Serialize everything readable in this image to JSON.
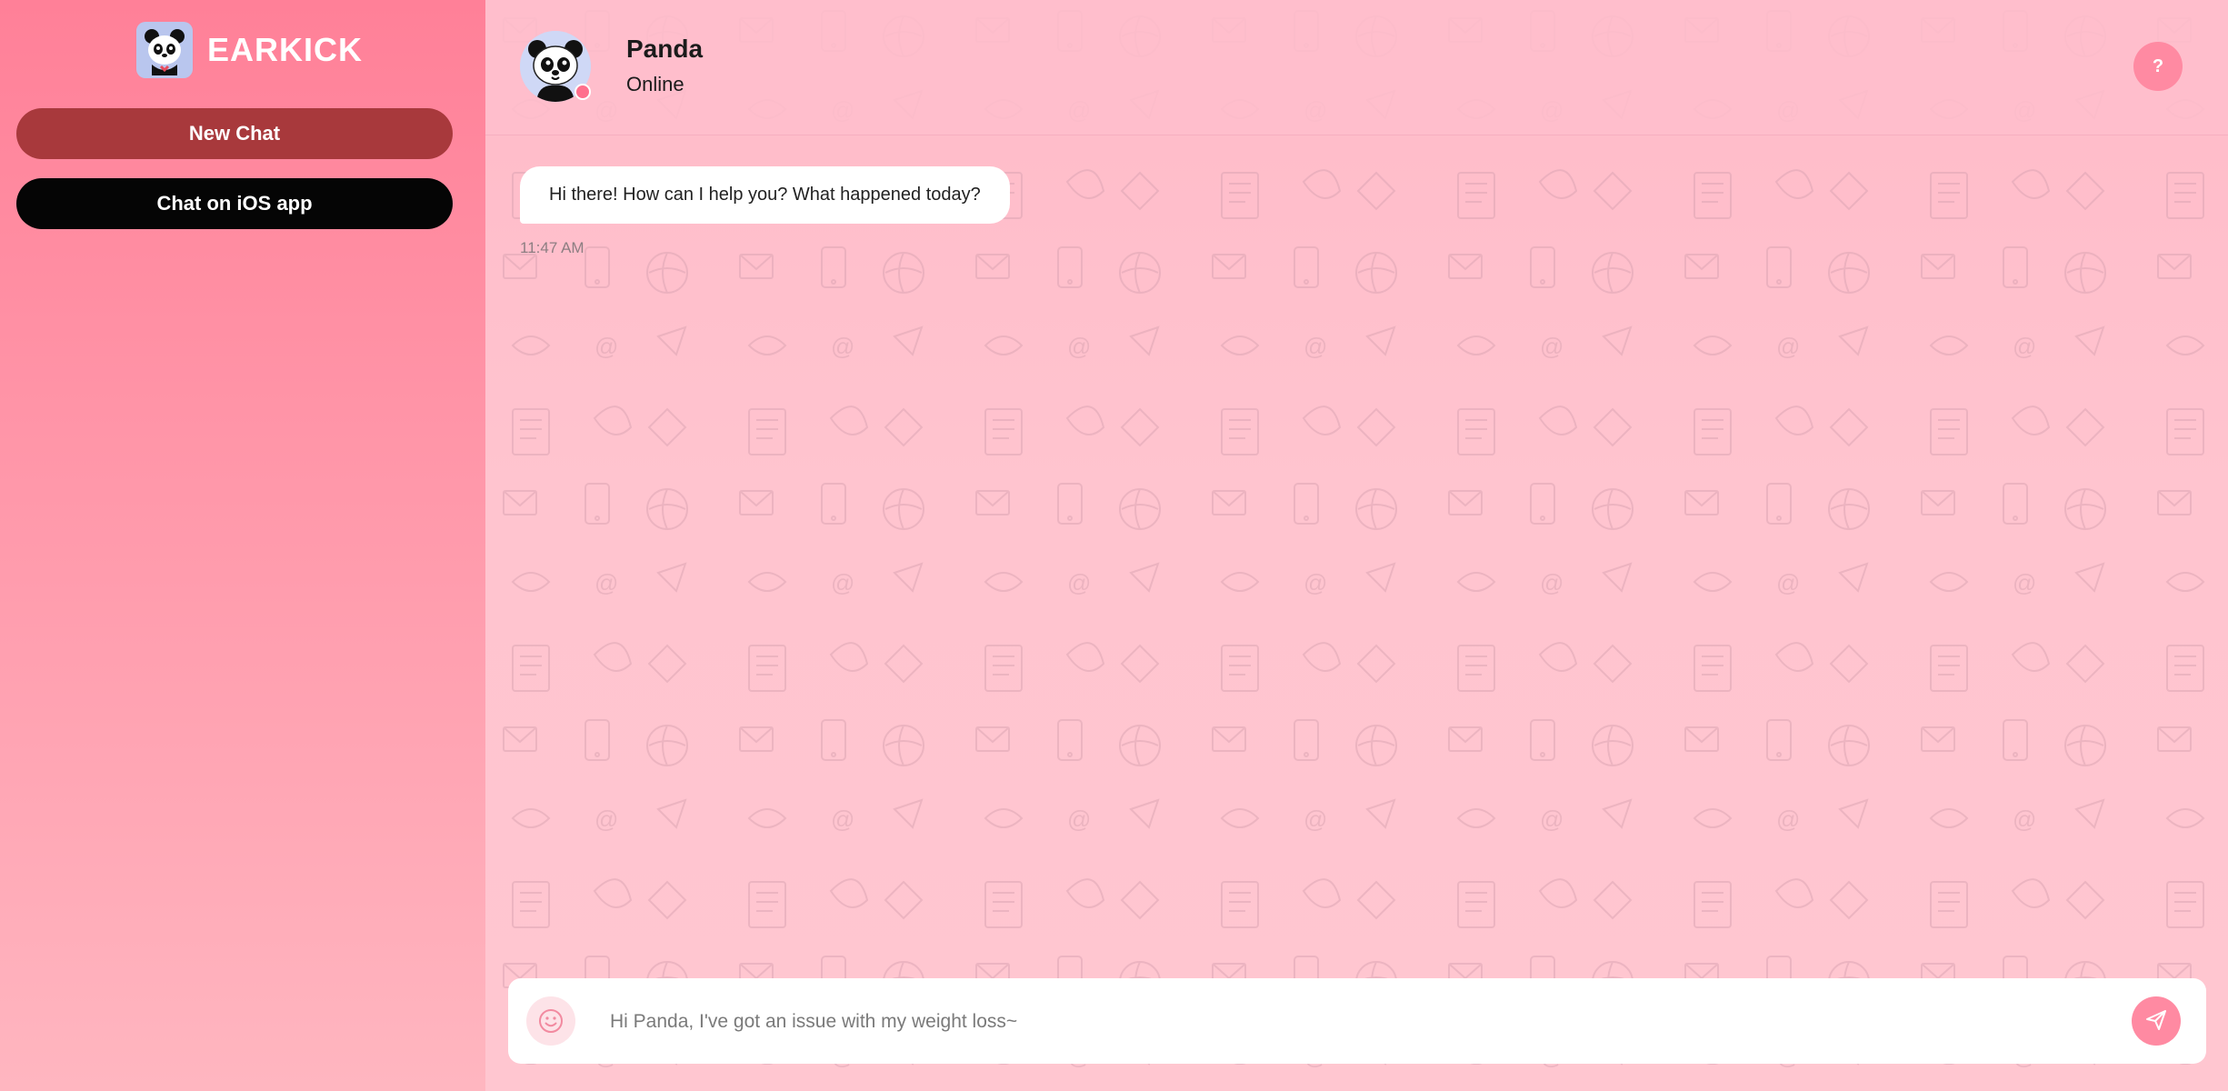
{
  "sidebar": {
    "brand_name": "EARKICK",
    "logo_icon": "panda-logo-icon",
    "buttons": {
      "new_chat": "New Chat",
      "ios_app": "Chat on iOS app"
    }
  },
  "header": {
    "contact_name": "Panda",
    "contact_status": "Online",
    "help_label": "?",
    "avatar_icon": "panda-avatar-icon"
  },
  "messages": [
    {
      "text": "Hi there! How can I help you? What happened today?",
      "time": "11:47 AM"
    }
  ],
  "composer": {
    "placeholder": "Hi Panda, I've got an issue with my weight loss~",
    "emoji_icon": "smiley-icon",
    "send_icon": "paper-plane-icon"
  },
  "colors": {
    "sidebar_top": "#ff8098",
    "new_chat_button": "#a8393c",
    "ios_button": "#050505",
    "accent": "#ff8aa2",
    "status_dot": "#ff6f8d"
  }
}
